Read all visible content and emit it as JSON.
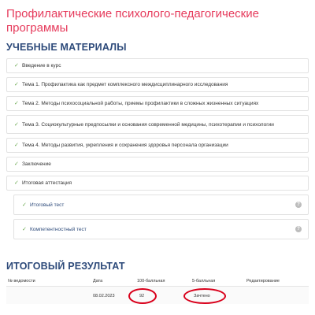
{
  "page": {
    "title": "Профилактические психолого-педагогические программы"
  },
  "materials": {
    "heading": "УЧЕБНЫЕ МАТЕРИАЛЫ",
    "items": [
      {
        "label": "Введение в курс"
      },
      {
        "label": "Тема 1. Профилактика как предмет комплексного междисциплинарного исследования"
      },
      {
        "label": "Тема 2. Методы психосоциальной работы, приемы профилактики в сложных жизненных ситуациях"
      },
      {
        "label": "Тема 3. Социокультурные предпосылки и основания современной медицины, психотерапии и психологии"
      },
      {
        "label": "Тема 4. Методы развития, укрепления и сохранения здоровья персонала организации"
      },
      {
        "label": "Заключение"
      },
      {
        "label": "Итоговая аттестация"
      }
    ],
    "sub_items": [
      {
        "label": "Итоговый тест",
        "help": "?"
      },
      {
        "label": "Компетентностный тест",
        "help": "?"
      }
    ]
  },
  "results": {
    "heading": "ИТОГОВЫЙ РЕЗУЛЬТАТ",
    "columns": [
      "№ ведомости",
      "Дата",
      "100-балльная",
      "5-балльная",
      "Редактирование"
    ],
    "rows": [
      {
        "number": "",
        "date": "08.02.2023",
        "score100": "92",
        "score5": "Зачтено",
        "edit": ""
      }
    ]
  },
  "colors": {
    "title": "#e63b5c",
    "heading": "#2d4a7a",
    "check": "#6aa84f",
    "highlight_ring": "#d9001b"
  },
  "icons": {
    "check": "check-icon",
    "help": "help-icon"
  }
}
